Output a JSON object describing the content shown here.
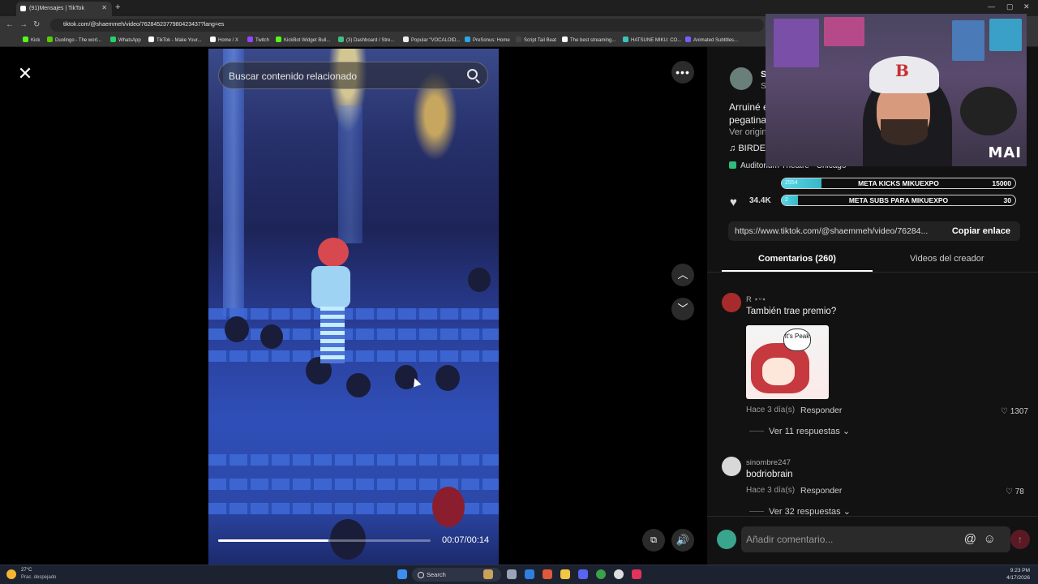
{
  "browser": {
    "tab_title": "(91)Mensajes | TikTok",
    "url": "tiktok.com/@shaemmeh/video/7628452377980423437?lang=es",
    "bookmarks": [
      {
        "label": "Kick",
        "color": "#53fc18"
      },
      {
        "label": "Duolingo - The worl...",
        "color": "#58cc02"
      },
      {
        "label": "WhatsApp",
        "color": "#25d366"
      },
      {
        "label": "TikTok - Make Your...",
        "color": "#ffffff"
      },
      {
        "label": "Home / X",
        "color": "#ffffff"
      },
      {
        "label": "Twitch",
        "color": "#9146ff"
      },
      {
        "label": "KickBot Widget Buil...",
        "color": "#53fc18"
      },
      {
        "label": "(3) Dashboard / Stre...",
        "color": "#3fbf7f"
      },
      {
        "label": "Popular \"VOCALOID...",
        "color": "#eeeeee"
      },
      {
        "label": "PreSonus: Home",
        "color": "#2aa6e0"
      },
      {
        "label": "Script Tail Beat",
        "color": "#444444"
      },
      {
        "label": "The best streaming...",
        "color": "#ffffff"
      },
      {
        "label": "HATSUNE MIKU: CO...",
        "color": "#39c5bb"
      },
      {
        "label": "Animated Subtitles...",
        "color": "#7b5cff"
      }
    ]
  },
  "video": {
    "search_placeholder": "Buscar contenido relacionado",
    "progress_percent": 52,
    "timecode": "00:07/00:14"
  },
  "panel": {
    "author_initial": "S",
    "author_sub": "S",
    "desc_line1": "Arruiné e",
    "desc_line2": "pegatina",
    "see_original": "Ver origin",
    "music": "BIRDE",
    "location": "Auditorium Theatre · Chicago",
    "likes": "34.4K",
    "comments_count": "260",
    "share_url": "https://www.tiktok.com/@shaemmeh/video/76284...",
    "copy_label": "Copiar enlace",
    "tabs": [
      "Comentarios (260)",
      "Videos del creador"
    ]
  },
  "comments": [
    {
      "name": "R ⋆ᵕ⋆",
      "text": "También trae premio?",
      "sticker_text": "It's Peak",
      "time": "Hace 3 día(s)",
      "reply": "Responder",
      "likes": "1307",
      "more": "Ver 11 respuestas"
    },
    {
      "name": "sinombre247",
      "text": "bodriobrain",
      "time": "Hace 3 día(s)",
      "reply": "Responder",
      "likes": "78",
      "more": "Ver 32 respuestas"
    }
  ],
  "comment_input_placeholder": "Añadir comentario...",
  "overlay": {
    "webcam_logo": "MAI",
    "goals": [
      {
        "current": "2554",
        "label": "META KICKS MIKUEXPO",
        "target": "15000",
        "fill_fraction": 0.17
      },
      {
        "current": "2",
        "label": "META SUBS PARA MIKUEXPO",
        "target": "30",
        "fill_fraction": 0.07
      }
    ]
  },
  "taskbar": {
    "weather_temp": "27°C",
    "weather_desc": "Prac. despejado",
    "search_label": "Search",
    "time": "9:23 PM",
    "date": "4/17/2026"
  },
  "colors": {
    "accent": "#fe2c55",
    "goal_fill": "#37b7c8"
  }
}
